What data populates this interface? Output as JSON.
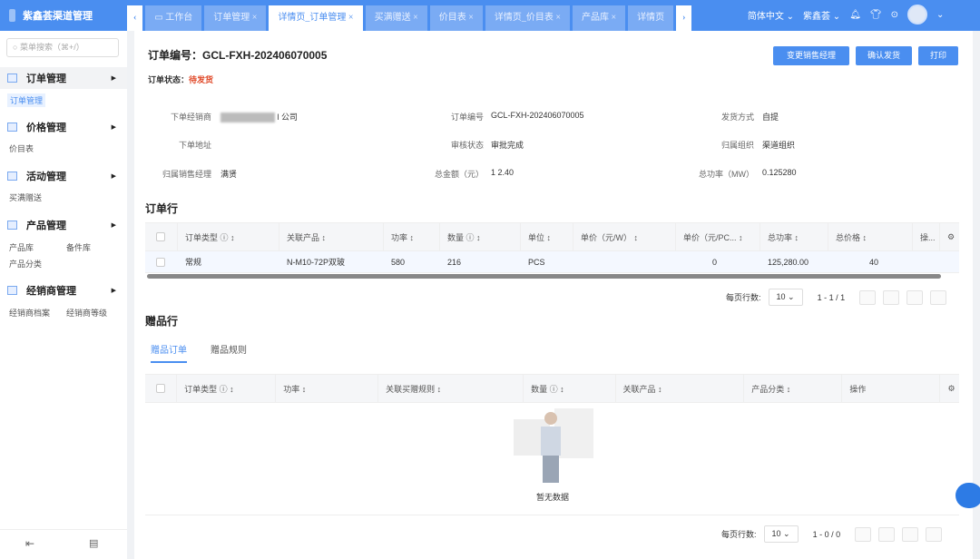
{
  "app": {
    "title": "紫鑫荟渠道管理"
  },
  "tabs": [
    {
      "label": "工作台",
      "icon": "monitor-icon"
    },
    {
      "label": "订单管理 ×"
    },
    {
      "label": "详情页_订单管理 ×",
      "active": true
    },
    {
      "label": "买满赠送 ×"
    },
    {
      "label": "价目表 ×"
    },
    {
      "label": "详情页_价目表 ×"
    },
    {
      "label": "产品库 ×"
    },
    {
      "label": "详情页"
    }
  ],
  "topbar": {
    "language": "简体中文",
    "org": "紫鑫荟"
  },
  "sidebar": {
    "search_placeholder": "菜单搜索（⌘+/）",
    "groups": [
      {
        "label": "订单管理",
        "items": [
          "订单管理"
        ]
      },
      {
        "label": "价格管理",
        "items": [
          "价目表"
        ]
      },
      {
        "label": "活动管理",
        "items": [
          "买满赠送"
        ]
      },
      {
        "label": "产品管理",
        "items": [
          "产品库",
          "备件库",
          "产品分类"
        ]
      },
      {
        "label": "经销商管理",
        "items": [
          "经销商档案",
          "经销商等级"
        ]
      }
    ]
  },
  "order": {
    "title": "订单编号：GCL-FXH-202406070005",
    "status_label": "订单状态：",
    "status": "待发货",
    "buttons": [
      "变更销售经理",
      "确认发货",
      "打印"
    ],
    "fields": [
      {
        "label": "下单经销商",
        "value": "l 公司"
      },
      {
        "label": "订单编号",
        "value": "GCL-FXH-202406070005"
      },
      {
        "label": "发货方式",
        "value": "自提"
      },
      {
        "label": "下单地址",
        "value": ""
      },
      {
        "label": "审核状态",
        "value": "审批完成"
      },
      {
        "label": "归属组织",
        "value": "渠道组织"
      },
      {
        "label": "归属销售经理",
        "value": "满贤"
      },
      {
        "label": "总金额（元）",
        "value": "1 2.40"
      },
      {
        "label": "总功率（MW）",
        "value": "0.125280"
      }
    ]
  },
  "order_lines": {
    "title": "订单行",
    "columns": [
      "订单类型 ⓘ ↕",
      "关联产品 ↕",
      "功率 ↕",
      "数量 ⓘ ↕",
      "单位 ↕",
      "单价（元/W） ↕",
      "单价（元/PC... ↕",
      "总功率 ↕",
      "总价格 ↕",
      "操..."
    ],
    "rows": [
      [
        "常规",
        "N-M10-72P双玻",
        "580",
        "216",
        "PCS",
        "",
        "0",
        "125,280.00",
        "40",
        ""
      ]
    ],
    "pagination": {
      "rows_label": "每页行数:",
      "page_size": "10",
      "range": "1 - 1 / 1"
    }
  },
  "gift": {
    "title": "赠品行",
    "tabs": [
      "赠品订单",
      "赠品规则"
    ],
    "columns": [
      "订单类型 ⓘ ↕",
      "功率 ↕",
      "关联买赠规则 ↕",
      "数量 ⓘ ↕",
      "关联产品 ↕",
      "产品分类 ↕",
      "操作"
    ],
    "empty": "暂无数据",
    "pagination": {
      "rows_label": "每页行数:",
      "page_size": "10",
      "range": "1 - 0 / 0"
    }
  }
}
